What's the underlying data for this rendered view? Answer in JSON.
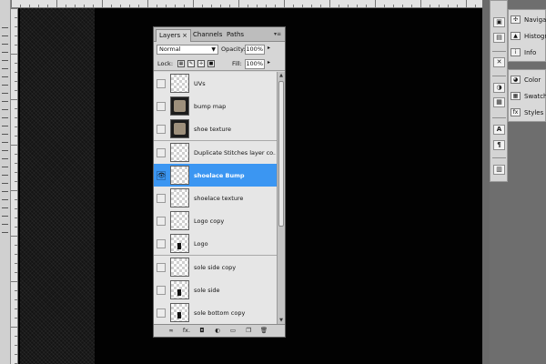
{
  "layers_panel": {
    "tabs": [
      {
        "label": "Layers",
        "close": "×",
        "active": true
      },
      {
        "label": "Channels",
        "active": false
      },
      {
        "label": "Paths",
        "active": false
      }
    ],
    "menu_icon": "panel-menu-icon",
    "blend_mode": "Normal",
    "opacity_label": "Opacity:",
    "opacity_value": "100%",
    "lock_label": "Lock:",
    "fill_label": "Fill:",
    "fill_value": "100%",
    "layers": [
      {
        "name": "UVs",
        "visible": false,
        "selected": false,
        "thumb": "transparent"
      },
      {
        "name": "bump map",
        "visible": false,
        "selected": false,
        "thumb": "image"
      },
      {
        "name": "shoe texture",
        "visible": false,
        "selected": false,
        "thumb": "image"
      },
      {
        "name": "Duplicate Stitches layer co...",
        "visible": false,
        "selected": false,
        "thumb": "transparent"
      },
      {
        "name": "shoelace Bump",
        "visible": true,
        "selected": true,
        "thumb": "transparent"
      },
      {
        "name": "shoelace texture",
        "visible": false,
        "selected": false,
        "thumb": "transparent"
      },
      {
        "name": "Logo copy",
        "visible": false,
        "selected": false,
        "thumb": "transparent"
      },
      {
        "name": "Logo",
        "visible": false,
        "selected": false,
        "thumb": "transparent-mark"
      },
      {
        "name": "sole side copy",
        "visible": false,
        "selected": false,
        "thumb": "transparent"
      },
      {
        "name": "sole side",
        "visible": false,
        "selected": false,
        "thumb": "transparent-mark"
      },
      {
        "name": "sole bottom copy",
        "visible": false,
        "selected": false,
        "thumb": "transparent-mark"
      }
    ],
    "visibility_icon": "👁",
    "footer_icons": [
      "link-icon",
      "fx-icon",
      "mask-icon",
      "adjustment-icon",
      "group-icon",
      "new-layer-icon",
      "trash-icon"
    ],
    "footer_glyphs": [
      "∞",
      "fx.",
      "◘",
      "◐",
      "▭",
      "❐",
      "🗑"
    ]
  },
  "dock": {
    "icon_column": [
      {
        "icon": "navigator-icon",
        "glyph": "▣"
      },
      {
        "icon": "histogram-icon",
        "glyph": "▤"
      },
      {
        "icon": "tools-icon",
        "glyph": "✕"
      },
      {
        "icon": "color-icon",
        "glyph": "◑"
      },
      {
        "icon": "swatches-icon",
        "glyph": "▦"
      },
      {
        "icon": "character-icon",
        "glyph": "A"
      },
      {
        "icon": "paragraph-icon",
        "glyph": "¶"
      },
      {
        "icon": "layers-icon",
        "glyph": "▥"
      }
    ],
    "group1": [
      {
        "label": "Navigator",
        "icon": "navigator-icon",
        "glyph": "✣"
      },
      {
        "label": "Histogram",
        "icon": "histogram-icon",
        "glyph": "▲"
      },
      {
        "label": "Info",
        "icon": "info-icon",
        "glyph": "i"
      }
    ],
    "group2": [
      {
        "label": "Color",
        "icon": "color-icon",
        "glyph": "◕"
      },
      {
        "label": "Swatches",
        "icon": "swatches-icon",
        "glyph": "▦"
      },
      {
        "label": "Styles",
        "icon": "styles-icon",
        "glyph": "fx"
      }
    ]
  }
}
